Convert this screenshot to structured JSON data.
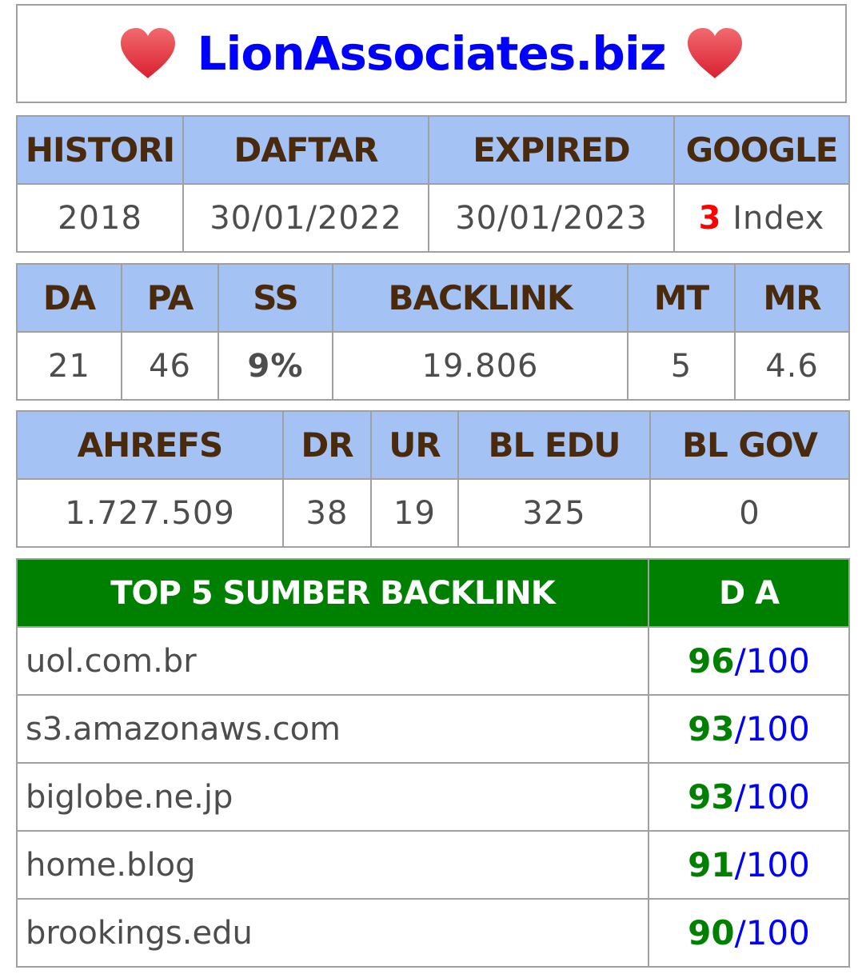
{
  "title": "LionAssociates.biz",
  "colors": {
    "header_bg": "#a4c2f4",
    "header_text": "#4a2a0c",
    "green_header": "#008000",
    "title": "#0000ff",
    "heart": "#e8343f"
  },
  "icons": {
    "left": "heart-icon",
    "right": "heart-icon"
  },
  "table1": {
    "headers": [
      "HISTORI",
      "DAFTAR",
      "EXPIRED",
      "GOOGLE"
    ],
    "values": {
      "histori": "2018",
      "daftar": "30/01/2022",
      "expired": "30/01/2023",
      "google_count": "3",
      "google_label": " Index"
    }
  },
  "table2": {
    "headers": [
      "DA",
      "PA",
      "SS",
      "BACKLINK",
      "MT",
      "MR"
    ],
    "values": [
      "21",
      "46",
      "9%",
      "19.806",
      "5",
      "4.6"
    ]
  },
  "table3": {
    "headers": [
      "AHREFS",
      "DR",
      "UR",
      "BL EDU",
      "BL GOV"
    ],
    "values": [
      "1.727.509",
      "38",
      "19",
      "325",
      "0"
    ]
  },
  "backlinks": {
    "header_source": "TOP 5 SUMBER BACKLINK",
    "header_da": "D A",
    "rows": [
      {
        "domain": "uol.com.br",
        "score": "96",
        "max": "/100"
      },
      {
        "domain": "s3.amazonaws.com",
        "score": "93",
        "max": "/100"
      },
      {
        "domain": "biglobe.ne.jp",
        "score": "93",
        "max": "/100"
      },
      {
        "domain": "home.blog",
        "score": "91",
        "max": "/100"
      },
      {
        "domain": "brookings.edu",
        "score": "90",
        "max": "/100"
      }
    ]
  }
}
